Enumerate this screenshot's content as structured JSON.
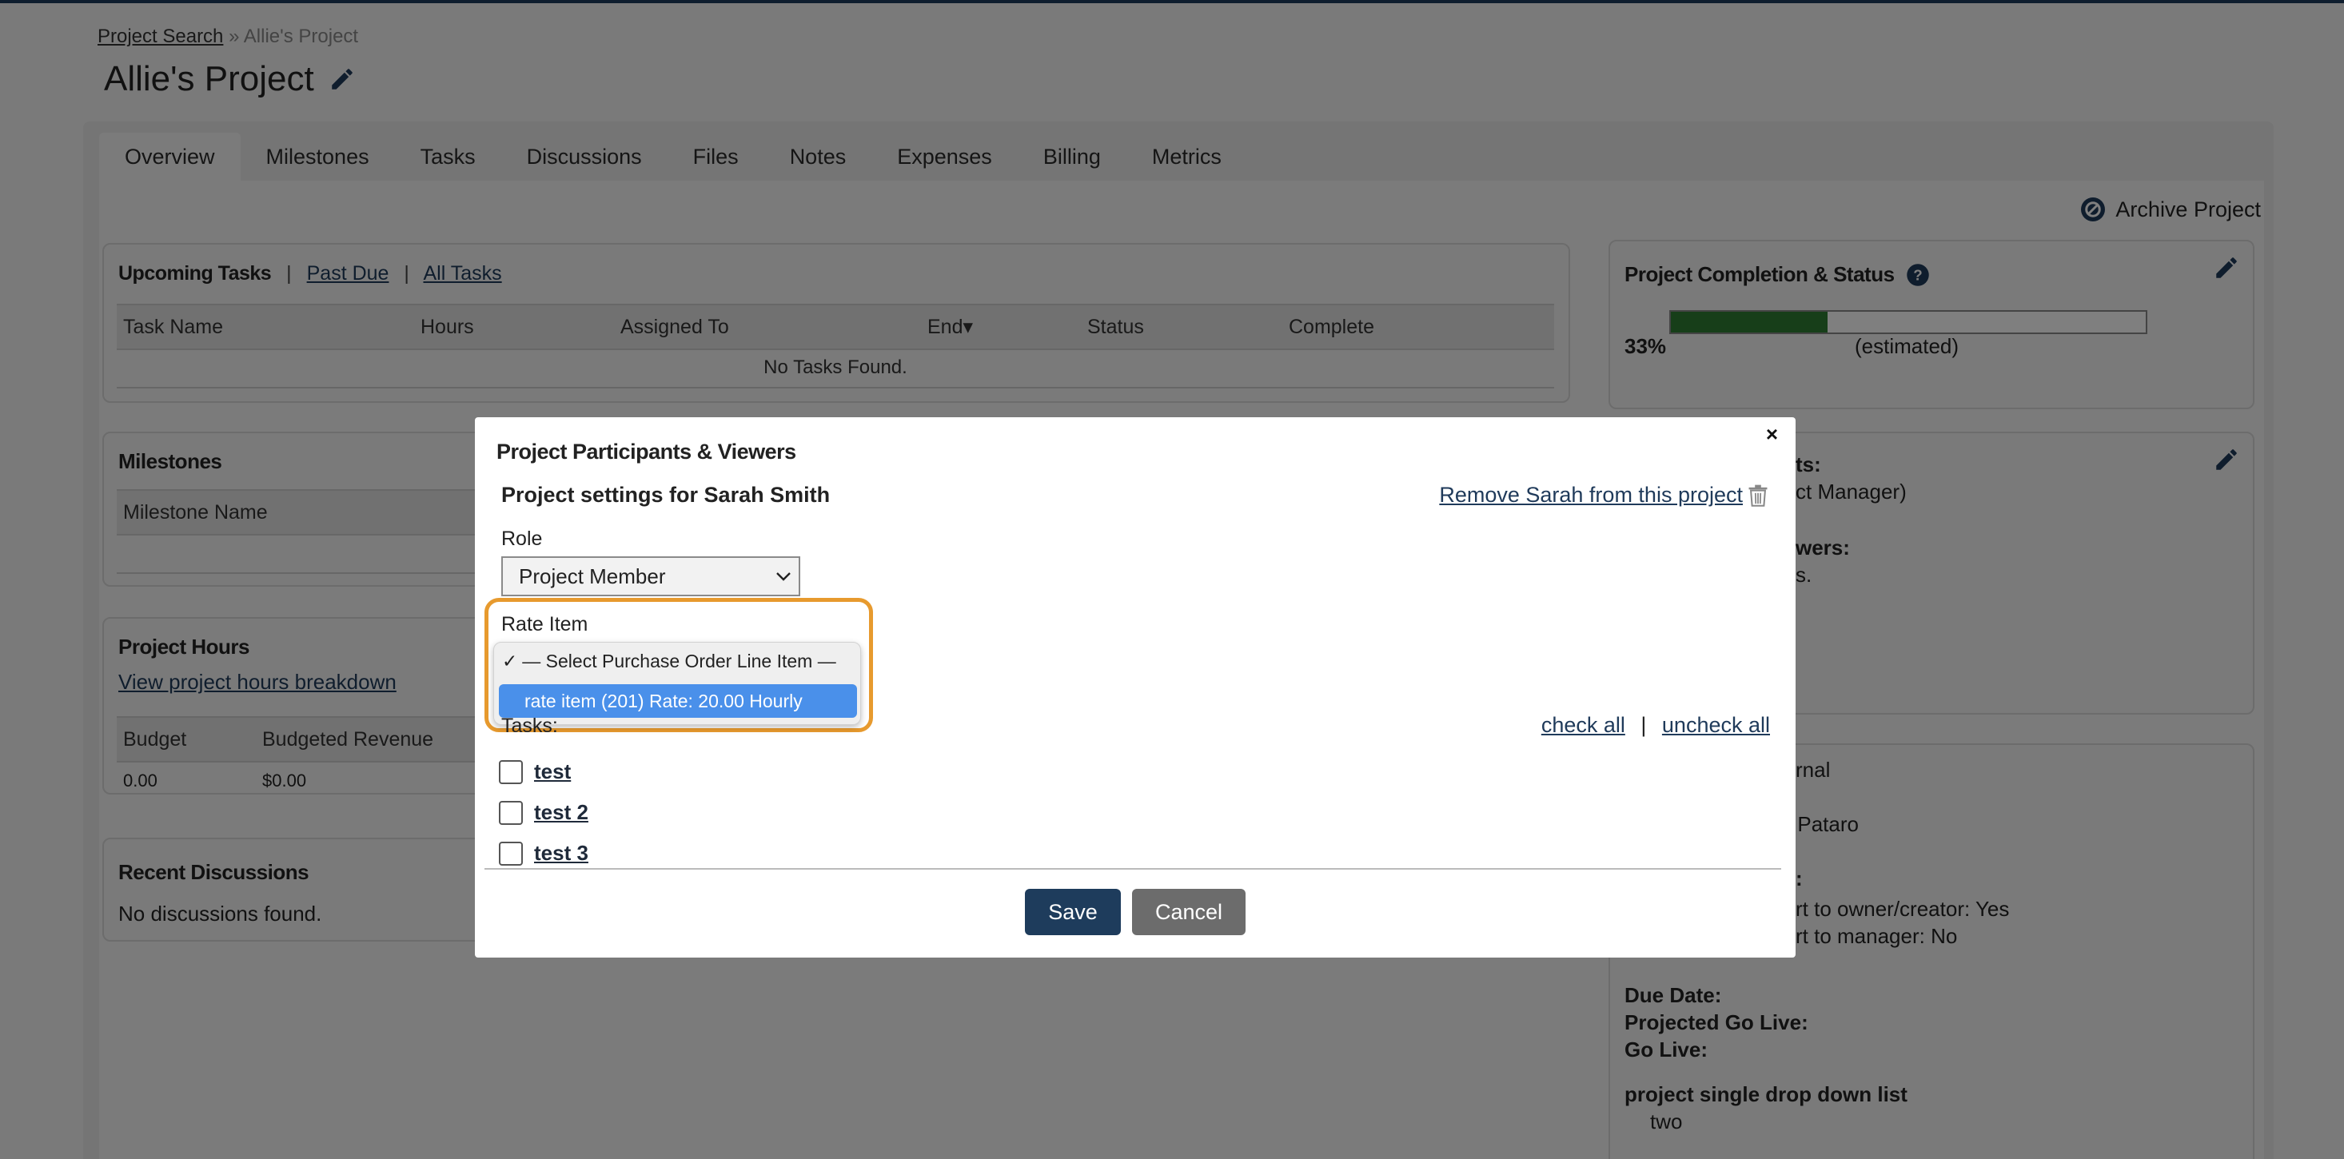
{
  "breadcrumb": {
    "root": "Project Search",
    "separator": "»",
    "current": "Allie's Project"
  },
  "project": {
    "title": "Allie's Project"
  },
  "tabs": [
    "Overview",
    "Milestones",
    "Tasks",
    "Discussions",
    "Files",
    "Notes",
    "Expenses",
    "Billing",
    "Metrics"
  ],
  "archive_label": "Archive Project",
  "tasks_card": {
    "upcoming": "Upcoming Tasks",
    "past_due": "Past Due",
    "all_tasks": "All Tasks",
    "sep": "|",
    "columns": [
      "Task Name",
      "Hours",
      "Assigned To",
      "End▾",
      "Status",
      "Complete"
    ],
    "empty": "No Tasks Found."
  },
  "milestones_card": {
    "title": "Milestones",
    "column": "Milestone Name"
  },
  "hours_card": {
    "title": "Project Hours",
    "link": "View project hours breakdown",
    "columns": [
      "Budget",
      "Budgeted Revenue"
    ],
    "values": [
      "0.00",
      "$0.00"
    ]
  },
  "discussions_card": {
    "title": "Recent Discussions",
    "empty": "No discussions found."
  },
  "status_card": {
    "title": "Project Completion & Status",
    "progress_percent": 33,
    "percent_label": "33%",
    "estimated": "(estimated)",
    "accent": "#2e7d32"
  },
  "participants_card": {
    "frag1": "ts:",
    "frag2": "ct Manager)",
    "frag3": "wers:",
    "frag4": "s."
  },
  "info_card": {
    "frag1": "rnal",
    "frag2": "Allie Pataro",
    "frag3": ":",
    "frag4": "rt to owner/creator: Yes",
    "frag5": "rt to manager: No",
    "due_date": "Due Date:",
    "projected_go_live": "Projected Go Live:",
    "go_live": "Go Live:",
    "dropdown_label": "project single drop down list",
    "dropdown_value": "two"
  },
  "modal": {
    "title": "Project Participants & Viewers",
    "close": "×",
    "subtitle": "Project settings for Sarah Smith",
    "remove": "Remove Sarah from this project",
    "role_label": "Role",
    "role_value": "Project Member",
    "rate_label": "Rate Item",
    "rate_options": [
      "— Select Purchase Order Line Item —",
      "rate item (201) Rate: 20.00 Hourly"
    ],
    "check_mark": "✓",
    "tasks_label": "Tasks:",
    "check_all": "check all",
    "uncheck_all": "uncheck all",
    "sep": "|",
    "tasks": [
      "test",
      "test 2",
      "test 3"
    ],
    "save": "Save",
    "cancel": "Cancel"
  }
}
